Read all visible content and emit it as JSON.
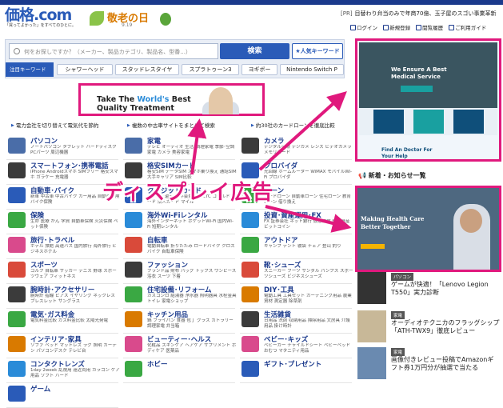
{
  "header": {
    "logo_brand": "価格.com",
    "logo_tagline": "「買ってよかった」をすべてのひとに。",
    "event_title": "敬老の日",
    "event_date": "9.19",
    "pr_tag": "[PR]",
    "pr_text": "目替わり弁当のみで年商70億、玉子屋のスゴい事業革新",
    "links": [
      "ログイン",
      "新規登録",
      "閲覧履歴",
      "ご利用ガイド"
    ]
  },
  "search": {
    "placeholder": "何をお探しですか？（メーカー、製品カテゴリ、製品名、型番...）",
    "button": "検索",
    "popular_button": "★人気キーワード",
    "keyword_label": "注目キーワード",
    "keywords": [
      "シャワーヘッド",
      "スタッドレスタイヤ",
      "スプラトゥーン3",
      "ヨギボー",
      "Nintendo Switch P"
    ]
  },
  "ad_banner": {
    "line1_prefix": "Take The ",
    "line1_highlight": "World's",
    "line1_suffix": " Best",
    "line2": "Quality Treatment"
  },
  "info_links": [
    "電力会社を切り替えて電気代を節約",
    "複数の中古車サイトをまとめて検索",
    "約30社のカードローンを徹底比較"
  ],
  "overlay_text": "ディスプレイ広告",
  "categories_left": [
    {
      "name": "パソコン",
      "sub": "ノートパソコン タブレット ハードディスク PCパーツ 周辺機器",
      "color": "#4a6da8"
    },
    {
      "name": "スマートフォン･携帯電話",
      "sub": "iPhone Androidスマホ SIMフリー 格安スマホ ガラケー 充電器",
      "color": "#3b3b3b"
    },
    {
      "name": "自動車･バイク",
      "sub": "新車 中古車 中古バイク カー用品 自動車保険 バイク保険",
      "color": "#2a5bb8"
    },
    {
      "name": "保険",
      "sub": "生命 医療 がん 学資 自動車保険 火災保険 ペット保険",
      "color": "#3aa843"
    },
    {
      "name": "旅行･トラベル",
      "sub": "ホテル 旅館 高速バス 国内旅行 海外旅行 ビジネスホテル",
      "color": "#d94a8c"
    },
    {
      "name": "スポーツ",
      "sub": "ゴルフ 自転車 サッカー テニス 野球 スポーツウェア フィットネス",
      "color": "#d94a3a"
    },
    {
      "name": "腕時計･アクセサリー",
      "sub": "腕時計 指輪 ピアス イヤリング ネックレス ブレスレット サングラス",
      "color": "#3b3b3b"
    },
    {
      "name": "電気･ガス料金",
      "sub": "電気料金比較 ガス料金比較 太陽光発電",
      "color": "#3aa843"
    },
    {
      "name": "インテリア･家具",
      "sub": "ソファ ベッド マットレス ラグ 照明 カーテン パソコンデスク テレビ台",
      "color": "#d97a00"
    },
    {
      "name": "コンタクトレンズ",
      "sub": "1day 2week 乱視用 遠近両用 カラコン ケア用品 ソフト ハード",
      "color": "#2a8bd8"
    },
    {
      "name": "ゲーム",
      "sub": "",
      "color": "#2a5bb8"
    }
  ],
  "categories_mid": [
    {
      "name": "家電",
      "sub": "テレビ オーディオ 生活･調理家電 季節･空調家電 カメラ 美容家電",
      "color": "#4a6da8"
    },
    {
      "name": "格安SIMカード",
      "sub": "格安SIM データSIM スマホ乗り換え 通話SIM 大手キャリア SIM比較",
      "color": "#3b3b3b"
    },
    {
      "name": "クレジットカード",
      "sub": "ポイント還元率 年会費無料 ETC ゴールドカード 法人カード マイル",
      "color": "#2a5bb8"
    },
    {
      "name": "海外Wi-Fiレンタル",
      "sub": "海外インターネット ポケットWi-Fi 国内Wi-Fi 短期レンタル",
      "color": "#2a8bd8"
    },
    {
      "name": "自転車",
      "sub": "電動自転車 折りたたみ ロードバイク クロスバイク 自転車保険",
      "color": "#d94a3a"
    },
    {
      "name": "ファッション",
      "sub": "ブランド品 財布 バッグ トップス ワンピース 浴衣 スーツ 下着",
      "color": "#3b3b3b"
    },
    {
      "name": "住宅設備･リフォーム",
      "sub": "ガスコンロ 給湯器 浄水器 照明器具 水栓金具 トイレ 家電ショップ",
      "color": "#3aa843"
    },
    {
      "name": "キッチン用品",
      "sub": "鍋 フライパン 食器 包丁 グラス カトラリー 調理家電 弁当箱",
      "color": "#d97a00"
    },
    {
      "name": "ビューティー･ヘルス",
      "sub": "化粧品 スキンケア ヘアケア サプリメント ボディケア 医薬品",
      "color": "#d94a8c"
    },
    {
      "name": "ホビー",
      "sub": "",
      "color": "#3aa843"
    }
  ],
  "categories_right": [
    {
      "name": "カメラ",
      "sub": "デジタル一眼 デジカメ レンズ ビデオカメラ メモリカード",
      "color": "#3b3b3b"
    },
    {
      "name": "プロバイダ",
      "sub": "光回線 ホームルーター WiMAX モバイルWi-Fi プロバイダ",
      "color": "#2a5bb8"
    },
    {
      "name": "ローン",
      "sub": "カードローン 自動車ローン 住宅ローン 教育ローン 借り換え",
      "color": "#3aa843"
    },
    {
      "name": "投資･資産運用･FX",
      "sub": "FX 証券会社 ネット銀行 仮想通貨 暗号資産 ビットコイン",
      "color": "#2a8bd8"
    },
    {
      "name": "アウトドア",
      "sub": "キャンプ テント 寝袋 チェア 登山 釣り",
      "color": "#3aa843"
    },
    {
      "name": "靴･シューズ",
      "sub": "スニーカー ブーツ サンダル パンプス スポーツシューズ ビジネスシューズ",
      "color": "#d94a3a"
    },
    {
      "name": "DIY･工具",
      "sub": "電動工具 工具セット ガーデニング用品 農業資材 測定器 除草剤",
      "color": "#d97a00"
    },
    {
      "name": "生活雑貨",
      "sub": "日用品 洗剤 収納用品 掃除用品 文房具 介護用品 掛け時計",
      "color": "#3b3b3b"
    },
    {
      "name": "ベビー･キッズ",
      "sub": "ベビーカー チャイルドシート ベビーベッド おむつ マタニティ用品",
      "color": "#d94a8c"
    },
    {
      "name": "ギフト･プレゼント",
      "sub": "",
      "color": "#2a5bb8"
    }
  ],
  "side_ad1": {
    "hero_title": "We Ensure A Best Medical Service",
    "footer_title": "Find An Doctor For Your Help"
  },
  "news_header": "新着・お知らせ一覧",
  "side_ad2": {
    "title": "Making Health Care Better Together"
  },
  "news": [
    {
      "category": "パソコン",
      "title": "ゲームが快適！「Lenovo Legion T550」実力診断"
    },
    {
      "category": "家電",
      "title": "オーディオテクニカのフラッグシップ「ATH-TWX9」徹底レビュー"
    },
    {
      "category": "家電",
      "title": "画像付きレビュー投稿でAmazonギフト券1万円分が抽選で当たる"
    }
  ],
  "colors": {
    "accent": "#e0197d",
    "brand": "#2a5bb8",
    "navy": "#1b3a8c"
  }
}
